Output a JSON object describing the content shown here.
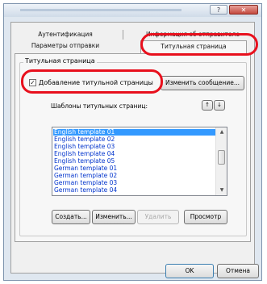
{
  "window": {
    "titlebar_buttons": [
      "?",
      "✕"
    ]
  },
  "tabs": {
    "row1": [
      "Аутентификация",
      "Информация об отправителе"
    ],
    "row2": [
      "Параметры отправки",
      "Титульная страница"
    ]
  },
  "cover_page": {
    "group_title": "Титульная страница",
    "add_checkbox_label": "Добавление титульной страницы",
    "add_checkbox_checked": true,
    "change_message_button": "Изменить сообщение...",
    "templates_label": "Шаблоны титульных страниц:",
    "sort_up": "↑",
    "sort_down": "↓",
    "templates": [
      "English template 01",
      "English template 02",
      "English template 03",
      "English template 04",
      "English template 05",
      "German template 01",
      "German template 02",
      "German template 03",
      "German template 04"
    ],
    "selected_index": 0,
    "create_button": "Создать...",
    "edit_button": "Изменить...",
    "delete_button": "Удалить",
    "preview_button": "Просмотр"
  },
  "footer": {
    "ok_button": "OK",
    "cancel_button": "Отмена"
  },
  "colors": {
    "highlight": "#e8101d",
    "selection": "#3399ff",
    "list_text": "#0033cc"
  },
  "icons": {
    "help": "help-icon",
    "close": "close-icon",
    "checkmark": "checkmark-icon",
    "scroll_up": "scroll-up-arrow-icon",
    "scroll_down": "scroll-down-arrow-icon"
  }
}
